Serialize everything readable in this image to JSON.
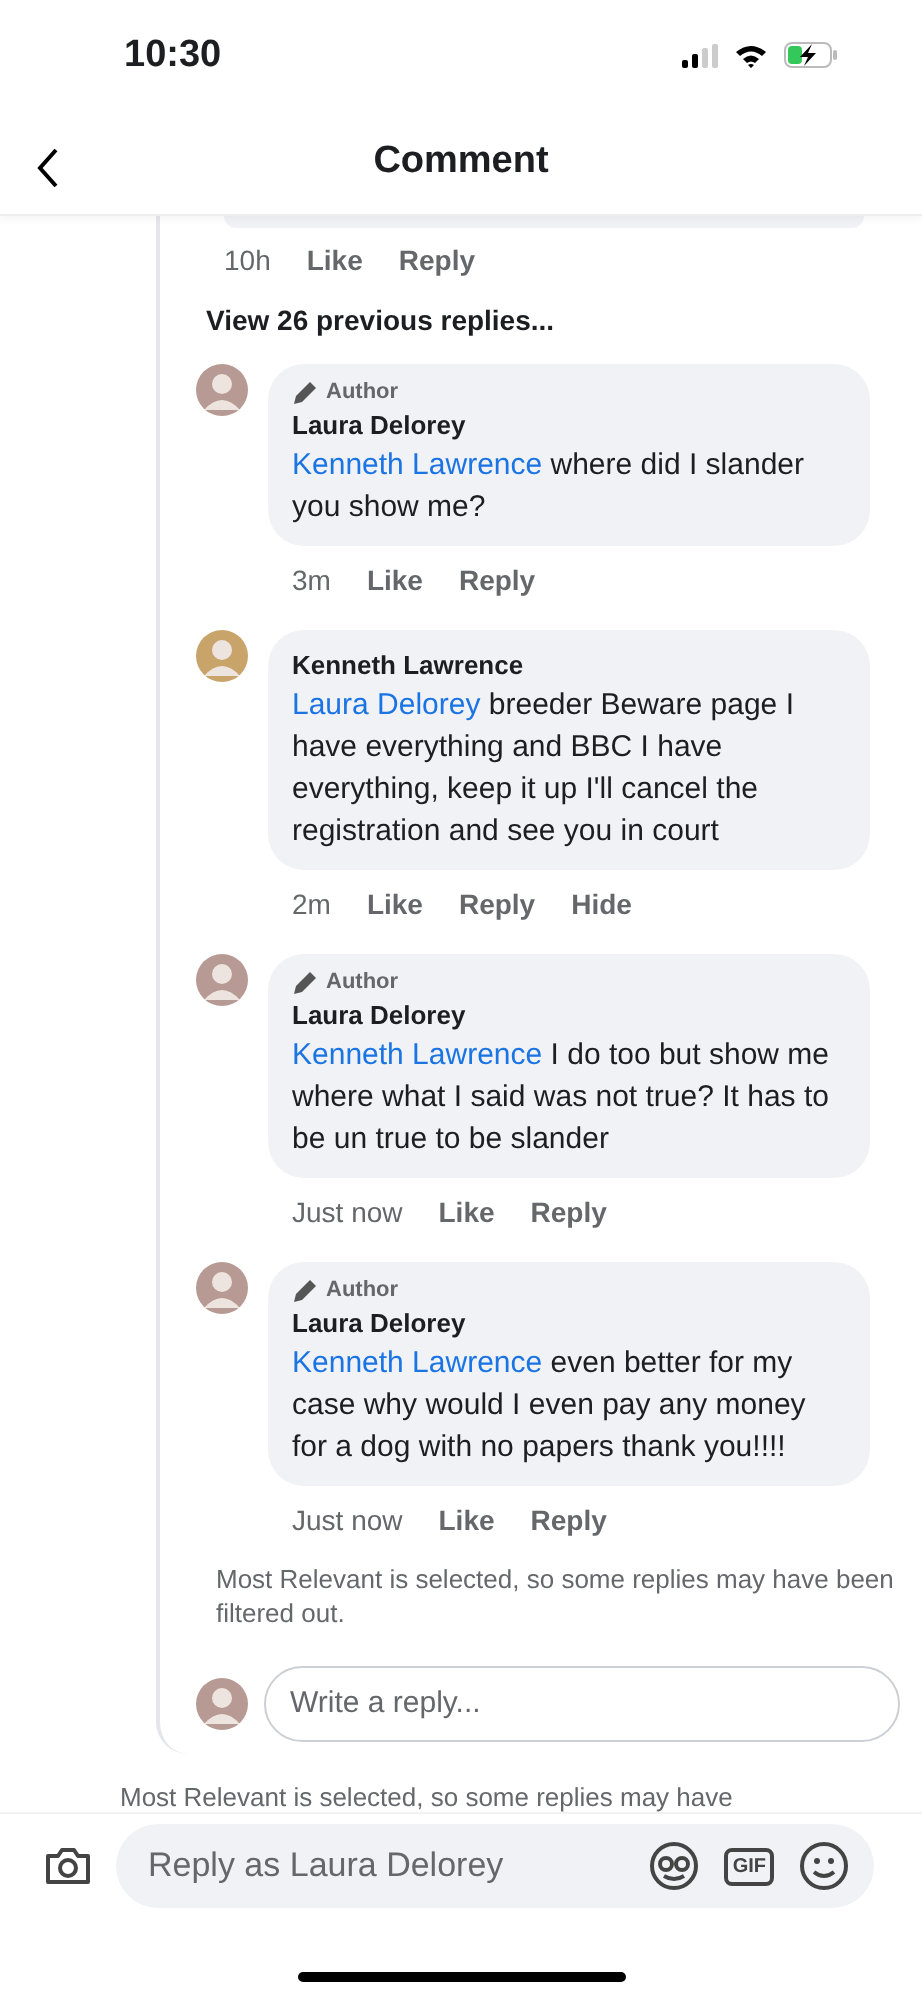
{
  "status_bar": {
    "time": "10:30"
  },
  "header": {
    "title": "Comment"
  },
  "previous_comment": {
    "time": "10h",
    "actions": [
      "Like",
      "Reply"
    ]
  },
  "view_previous": "View 26 previous replies...",
  "replies": [
    {
      "badge": "Author",
      "name": "Laura Delorey",
      "mention": "Kenneth Lawrence",
      "text": " where did I slander you show me?",
      "time": "3m",
      "actions": [
        "Like",
        "Reply"
      ]
    },
    {
      "name": "Kenneth Lawrence",
      "mention": "Laura Delorey",
      "text": "  breeder Beware page I have everything and BBC I have everything, keep it up I'll cancel the registration and see you in court",
      "time": "2m",
      "actions": [
        "Like",
        "Reply",
        "Hide"
      ]
    },
    {
      "badge": "Author",
      "name": "Laura Delorey",
      "mention": "Kenneth Lawrence",
      "text": " I do too but show me where what I said was not true? It has to be un true to be slander",
      "time": "Just now",
      "actions": [
        "Like",
        "Reply"
      ]
    },
    {
      "badge": "Author",
      "name": "Laura Delorey",
      "mention": "Kenneth Lawrence",
      "text": " even better for my case why would I even pay any money for a dog with no papers thank you!!!!",
      "time": "Just now",
      "actions": [
        "Like",
        "Reply"
      ]
    }
  ],
  "filter_note": "Most Relevant is selected, so some replies may have been filtered out.",
  "reply_field": {
    "placeholder": "Write a reply..."
  },
  "filter_note_2": "Most Relevant is selected, so some replies may have",
  "composer": {
    "placeholder": "Reply as Laura Delorey",
    "gif_label": "GIF"
  }
}
